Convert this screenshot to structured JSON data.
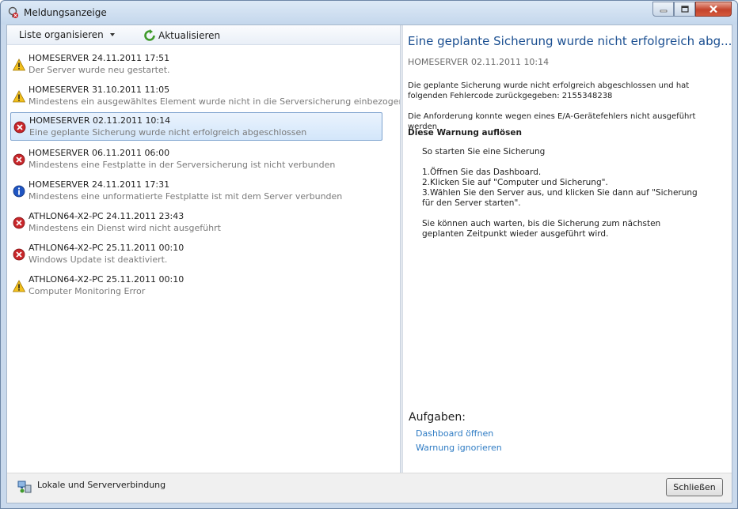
{
  "window": {
    "title": "Meldungsanzeige",
    "icon": "alert-viewer-icon"
  },
  "toolbar": {
    "organize_label": "Liste organisieren",
    "refresh_label": "Aktualisieren"
  },
  "alerts": [
    {
      "type": "warning",
      "icon": "warning-icon",
      "source": "HOMESERVER 24.11.2011 17:51",
      "message": "Der Server wurde neu gestartet.",
      "selected": false
    },
    {
      "type": "warning",
      "icon": "warning-icon",
      "source": "HOMESERVER 31.10.2011 11:05",
      "message": "Mindestens ein ausgewähltes Element wurde nicht in die Serversicherung einbezogen",
      "selected": false
    },
    {
      "type": "error",
      "icon": "error-icon",
      "source": "HOMESERVER 02.11.2011 10:14",
      "message": "Eine geplante Sicherung wurde nicht erfolgreich abgeschlossen",
      "selected": true
    },
    {
      "type": "error",
      "icon": "error-icon",
      "source": "HOMESERVER 06.11.2011 06:00",
      "message": "Mindestens eine Festplatte in der Serversicherung ist nicht verbunden",
      "selected": false
    },
    {
      "type": "info",
      "icon": "info-icon",
      "source": "HOMESERVER 24.11.2011 17:31",
      "message": "Mindestens eine unformatierte Festplatte ist mit dem Server verbunden",
      "selected": false
    },
    {
      "type": "error",
      "icon": "error-icon",
      "source": "ATHLON64-X2-PC 24.11.2011 23:43",
      "message": "Mindestens ein Dienst wird nicht ausgeführt",
      "selected": false
    },
    {
      "type": "error",
      "icon": "error-icon",
      "source": "ATHLON64-X2-PC 25.11.2011 00:10",
      "message": "Windows Update ist deaktiviert.",
      "selected": false
    },
    {
      "type": "warning",
      "icon": "warning-icon",
      "source": "ATHLON64-X2-PC 25.11.2011 00:10",
      "message": "Computer Monitoring Error",
      "selected": false
    }
  ],
  "detail": {
    "title": "Eine geplante Sicherung wurde nicht erfolgreich abg...",
    "subtitle": "HOMESERVER 02.11.2011 10:14",
    "paragraph1_line1": "Die geplante Sicherung wurde nicht erfolgreich abgeschlossen und hat",
    "paragraph1_line2": "folgenden Fehlercode zurückgegeben: 2155348238",
    "paragraph2": "Die Anforderung konnte wegen eines E/A-Gerätefehlers nicht ausgeführt werden",
    "resolve_heading": "Diese Warnung auflösen",
    "instructions_intro": "So starten Sie eine Sicherung",
    "step1": "1.Öffnen Sie das Dashboard.",
    "step2": "2.Klicken Sie auf \"Computer und Sicherung\".",
    "step3_line1": "3.Wählen Sie den Server aus, und klicken Sie dann auf \"Sicherung",
    "step3_line2": "für den Server starten\".",
    "note_line1": "Sie können auch warten, bis die Sicherung zum nächsten",
    "note_line2": "geplanten Zeitpunkt wieder ausgeführt wird."
  },
  "tasks": {
    "heading": "Aufgaben:",
    "open_dashboard": "Dashboard öffnen",
    "ignore_warning": "Warnung ignorieren"
  },
  "footer": {
    "connection_label": "Lokale und Serververbindung",
    "close_button": "Schließen"
  },
  "colors": {
    "title_blue": "#1b4f91",
    "link_blue": "#2f7cc4",
    "error_red": "#c8262a",
    "warning_yellow": "#f2c01c",
    "info_blue": "#1f55c2"
  }
}
